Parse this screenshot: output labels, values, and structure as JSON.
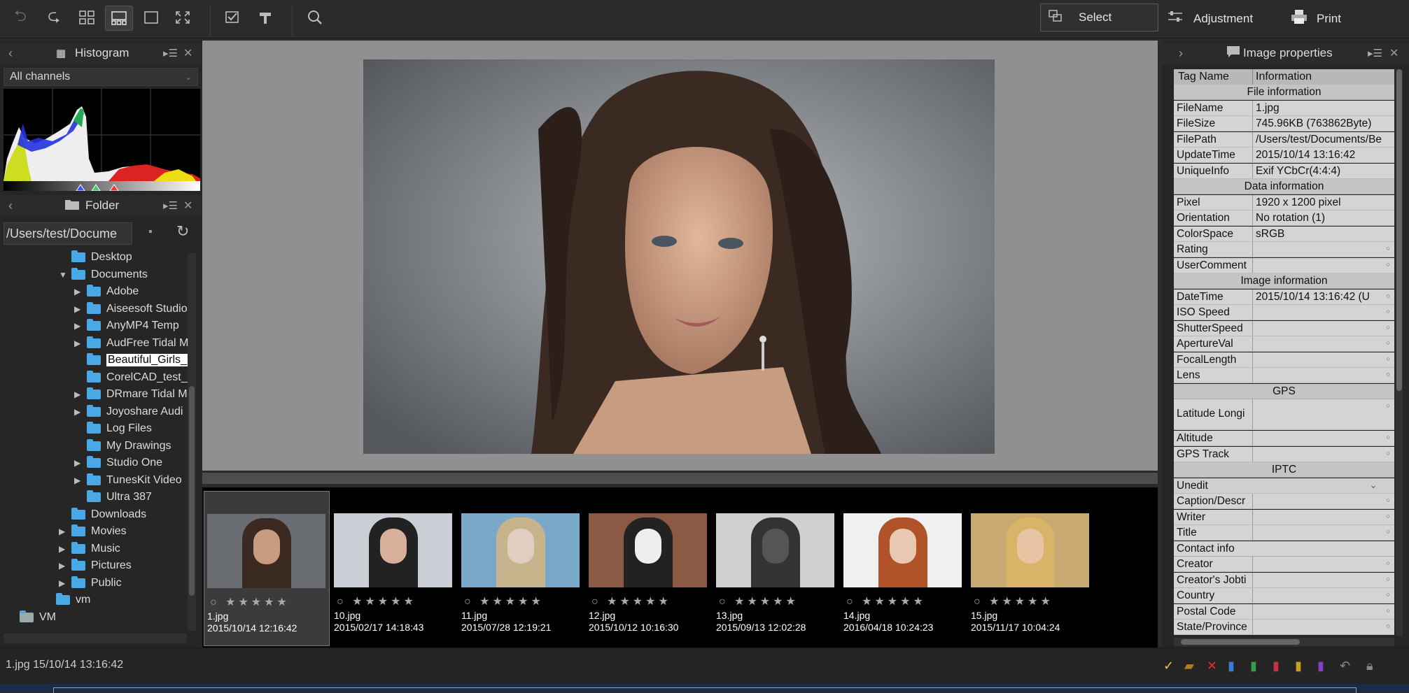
{
  "toolbar": {
    "select_label": "Select",
    "adjustment_label": "Adjustment",
    "print_label": "Print"
  },
  "histogram": {
    "title": "Histogram",
    "channel": "All channels"
  },
  "folder": {
    "title": "Folder",
    "path": "/Users/test/Docume",
    "tree": [
      {
        "label": "Desktop",
        "indent": 1,
        "arrow": ""
      },
      {
        "label": "Documents",
        "indent": 1,
        "arrow": "▼"
      },
      {
        "label": "Adobe",
        "indent": 2,
        "arrow": "▶"
      },
      {
        "label": "Aiseesoft Studio",
        "indent": 2,
        "arrow": "▶"
      },
      {
        "label": "AnyMP4 Temp",
        "indent": 2,
        "arrow": "▶"
      },
      {
        "label": "AudFree Tidal M",
        "indent": 2,
        "arrow": "▶"
      },
      {
        "label": "Beautiful_Girls_",
        "indent": 2,
        "arrow": "",
        "selected": true
      },
      {
        "label": "CorelCAD_test_",
        "indent": 2,
        "arrow": ""
      },
      {
        "label": "DRmare Tidal M",
        "indent": 2,
        "arrow": "▶"
      },
      {
        "label": "Joyoshare Audi",
        "indent": 2,
        "arrow": "▶"
      },
      {
        "label": "Log Files",
        "indent": 2,
        "arrow": ""
      },
      {
        "label": "My Drawings",
        "indent": 2,
        "arrow": ""
      },
      {
        "label": "Studio One",
        "indent": 2,
        "arrow": "▶"
      },
      {
        "label": "TunesKit Video",
        "indent": 2,
        "arrow": "▶"
      },
      {
        "label": "Ultra 387",
        "indent": 2,
        "arrow": ""
      },
      {
        "label": "Downloads",
        "indent": 1,
        "arrow": ""
      },
      {
        "label": "Movies",
        "indent": 1,
        "arrow": "▶"
      },
      {
        "label": "Music",
        "indent": 1,
        "arrow": "▶"
      },
      {
        "label": "Pictures",
        "indent": 1,
        "arrow": "▶"
      },
      {
        "label": "Public",
        "indent": 1,
        "arrow": "▶"
      },
      {
        "label": "vm",
        "indent": 0,
        "arrow": ""
      },
      {
        "label": "VM",
        "indent": -1,
        "arrow": ""
      }
    ]
  },
  "properties": {
    "title": "Image properties",
    "col_tag": "Tag Name",
    "col_info": "Information",
    "sections": {
      "file": "File information",
      "data": "Data information",
      "image": "Image information",
      "gps": "GPS",
      "iptc": "IPTC",
      "contact": "Contact info"
    },
    "rows": {
      "filename": [
        "FileName",
        "1.jpg"
      ],
      "filesize": [
        "FileSize",
        "745.96KB (763862Byte)"
      ],
      "filepath": [
        "FilePath",
        "/Users/test/Documents/Be"
      ],
      "updatetime": [
        "UpdateTime",
        "2015/10/14 13:16:42"
      ],
      "uniqueinfo": [
        "UniqueInfo",
        "Exif YCbCr(4:4:4)"
      ],
      "pixel": [
        "Pixel",
        "1920 x 1200 pixel"
      ],
      "orientation": [
        "Orientation",
        "No rotation (1)"
      ],
      "colorspace": [
        "ColorSpace",
        "sRGB"
      ],
      "rating": [
        "Rating",
        ""
      ],
      "usercomment": [
        "UserComment",
        ""
      ],
      "datetime": [
        "DateTime",
        "2015/10/14 13:16:42 (U"
      ],
      "iso": [
        "ISO Speed",
        ""
      ],
      "shutter": [
        "ShutterSpeed",
        ""
      ],
      "aperture": [
        "ApertureVal",
        ""
      ],
      "focal": [
        "FocalLength",
        ""
      ],
      "lens": [
        "Lens",
        ""
      ],
      "latlong": [
        "Latitude Longi",
        ""
      ],
      "altitude": [
        "Altitude",
        ""
      ],
      "gpstrack": [
        "GPS Track",
        ""
      ],
      "caption": [
        "Caption/Descr",
        ""
      ],
      "writer": [
        "Writer",
        ""
      ],
      "title": [
        "Title",
        ""
      ],
      "creator": [
        "Creator",
        ""
      ],
      "jobtitle": [
        "Creator's Jobti",
        ""
      ],
      "country": [
        "Country",
        ""
      ],
      "postal": [
        "Postal Code",
        ""
      ],
      "state": [
        "State/Province",
        ""
      ]
    },
    "iptc_select": "Unedit"
  },
  "thumbnails": [
    {
      "name": "1.jpg",
      "date": "2015/10/14 12:16:42"
    },
    {
      "name": "10.jpg",
      "date": "2015/02/17 14:18:43"
    },
    {
      "name": "11.jpg",
      "date": "2015/07/28 12:19:21"
    },
    {
      "name": "12.jpg",
      "date": "2015/10/12 10:16:30"
    },
    {
      "name": "13.jpg",
      "date": "2015/09/13 12:02:28"
    },
    {
      "name": "14.jpg",
      "date": "2016/04/18 10:24:23"
    },
    {
      "name": "15.jpg",
      "date": "2015/11/17 10:04:24"
    }
  ],
  "status": {
    "text": "1.jpg 15/10/14 13:16:42"
  }
}
